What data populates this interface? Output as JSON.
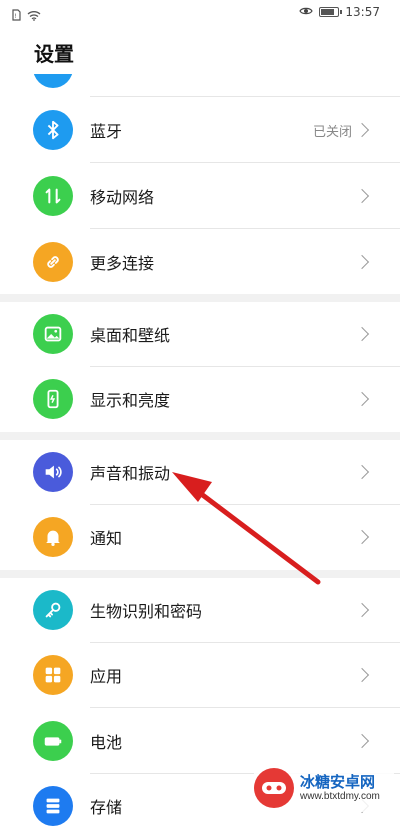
{
  "status_bar": {
    "time": "13:57",
    "battery_level": 0.8
  },
  "header": {
    "title": "设置"
  },
  "settings": [
    {
      "label": "蓝牙",
      "status": "已关闭",
      "icon": "bluetooth-icon",
      "color": "#1e9bf0"
    },
    {
      "label": "移动网络",
      "status": "",
      "icon": "mobile-data-icon",
      "color": "#3ccf4e"
    },
    {
      "label": "更多连接",
      "status": "",
      "icon": "link-icon",
      "color": "#f5a623"
    },
    {
      "label": "桌面和壁纸",
      "status": "",
      "icon": "wallpaper-icon",
      "color": "#3ccf4e"
    },
    {
      "label": "显示和亮度",
      "status": "",
      "icon": "display-icon",
      "color": "#3ccf4e"
    },
    {
      "label": "声音和振动",
      "status": "",
      "icon": "sound-icon",
      "color": "#4a5bdb"
    },
    {
      "label": "通知",
      "status": "",
      "icon": "bell-icon",
      "color": "#f5a623"
    },
    {
      "label": "生物识别和密码",
      "status": "",
      "icon": "key-icon",
      "color": "#1bb9c9"
    },
    {
      "label": "应用",
      "status": "",
      "icon": "apps-grid-icon",
      "color": "#f5a623"
    },
    {
      "label": "电池",
      "status": "",
      "icon": "battery-icon",
      "color": "#3ccf4e"
    },
    {
      "label": "存储",
      "status": "",
      "icon": "storage-icon",
      "color": "#1e7bf0"
    }
  ],
  "watermark": {
    "name": "冰糖安卓网",
    "url": "www.btxtdmy.com"
  }
}
